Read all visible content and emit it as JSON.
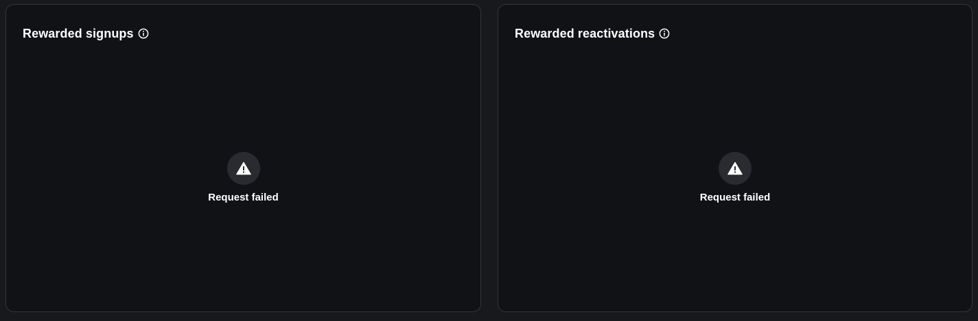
{
  "panels": [
    {
      "title": "Rewarded signups",
      "info_icon": "info-icon",
      "status_icon": "warning-icon",
      "status_text": "Request failed"
    },
    {
      "title": "Rewarded reactivations",
      "info_icon": "info-icon",
      "status_icon": "warning-icon",
      "status_text": "Request failed"
    }
  ],
  "colors": {
    "page_background": "#18191d",
    "card_background": "#111216",
    "card_border": "#34363c",
    "icon_circle": "#2a2b30",
    "text": "#ffffff"
  }
}
